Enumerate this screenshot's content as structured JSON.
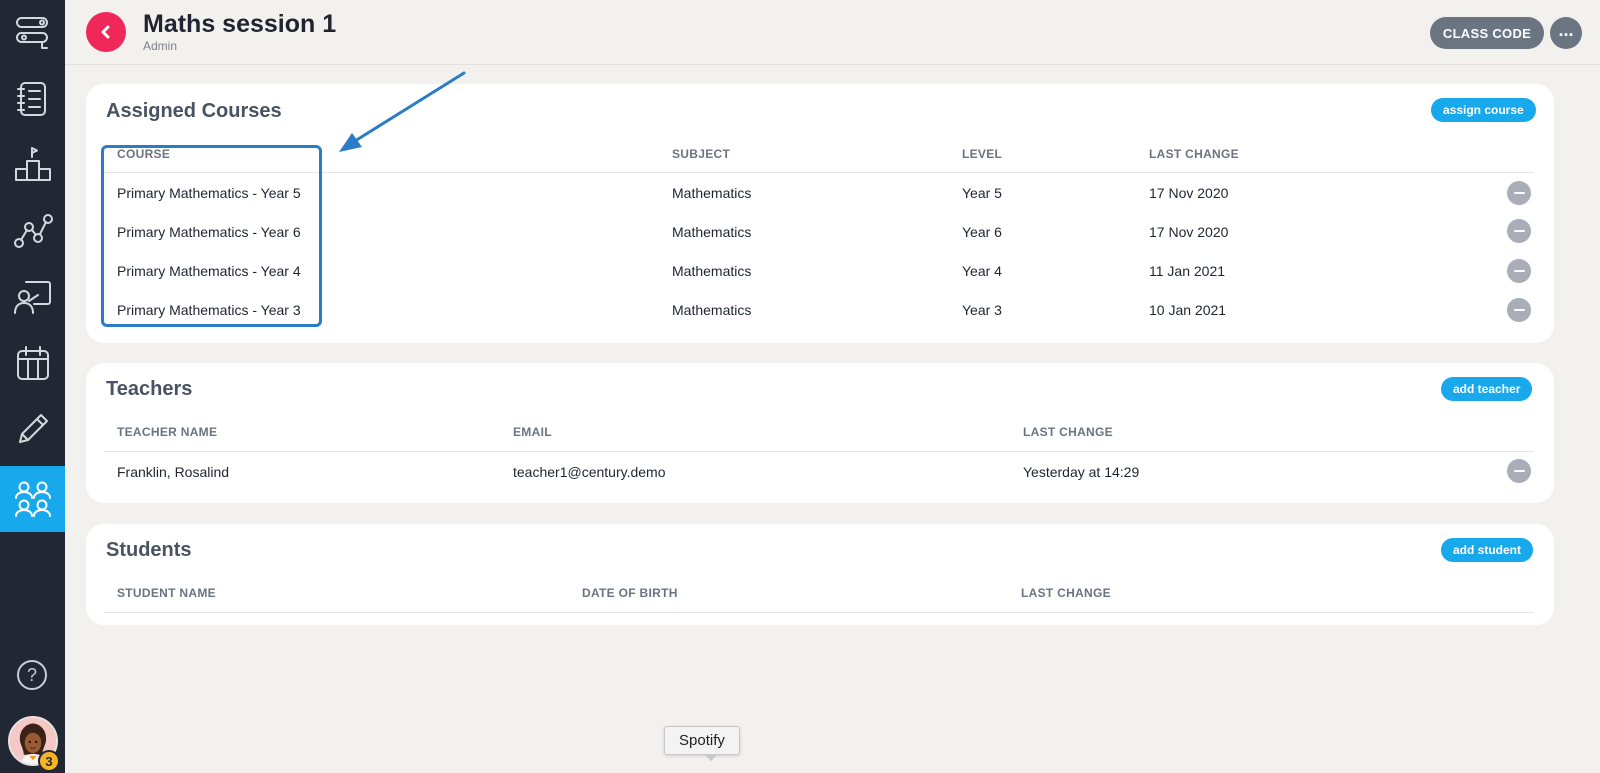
{
  "header": {
    "title": "Maths session 1",
    "subtitle": "Admin",
    "class_code_label": "CLASS CODE",
    "more_label": "..."
  },
  "sidebar": {
    "items": [
      {
        "icon": "workflow-icon",
        "active": false
      },
      {
        "icon": "checklist-icon",
        "active": false
      },
      {
        "icon": "podium-icon",
        "active": false
      },
      {
        "icon": "graph-nodes-icon",
        "active": false
      },
      {
        "icon": "presentation-icon",
        "active": false
      },
      {
        "icon": "calendar-icon",
        "active": false
      },
      {
        "icon": "pencil-icon",
        "active": false
      },
      {
        "icon": "users-icon",
        "active": true
      }
    ],
    "help_label": "?",
    "avatar_badge": "3"
  },
  "courses": {
    "title": "Assigned Courses",
    "action_label": "assign course",
    "columns": [
      "COURSE",
      "SUBJECT",
      "LEVEL",
      "LAST CHANGE"
    ],
    "rows": [
      {
        "course": "Primary Mathematics - Year 5",
        "subject": "Mathematics",
        "level": "Year 5",
        "last_change": "17 Nov 2020"
      },
      {
        "course": "Primary Mathematics - Year 6",
        "subject": "Mathematics",
        "level": "Year 6",
        "last_change": "17 Nov 2020"
      },
      {
        "course": "Primary Mathematics - Year 4",
        "subject": "Mathematics",
        "level": "Year 4",
        "last_change": "11 Jan 2021"
      },
      {
        "course": "Primary Mathematics - Year 3",
        "subject": "Mathematics",
        "level": "Year 3",
        "last_change": "10 Jan 2021"
      }
    ]
  },
  "teachers": {
    "title": "Teachers",
    "action_label": "add teacher",
    "columns": [
      "TEACHER NAME",
      "EMAIL",
      "LAST CHANGE"
    ],
    "rows": [
      {
        "name": "Franklin, Rosalind",
        "email": "teacher1@century.demo",
        "last_change": "Yesterday at 14:29"
      }
    ]
  },
  "students": {
    "title": "Students",
    "action_label": "add student",
    "columns": [
      "STUDENT NAME",
      "DATE OF BIRTH",
      "LAST CHANGE"
    ],
    "rows": []
  },
  "tooltip": {
    "label": "Spotify"
  },
  "colors": {
    "sidebar_bg": "#212833",
    "accent": "#18a8ec",
    "back_button": "#f0285a",
    "annotation": "#2a7cc7"
  }
}
